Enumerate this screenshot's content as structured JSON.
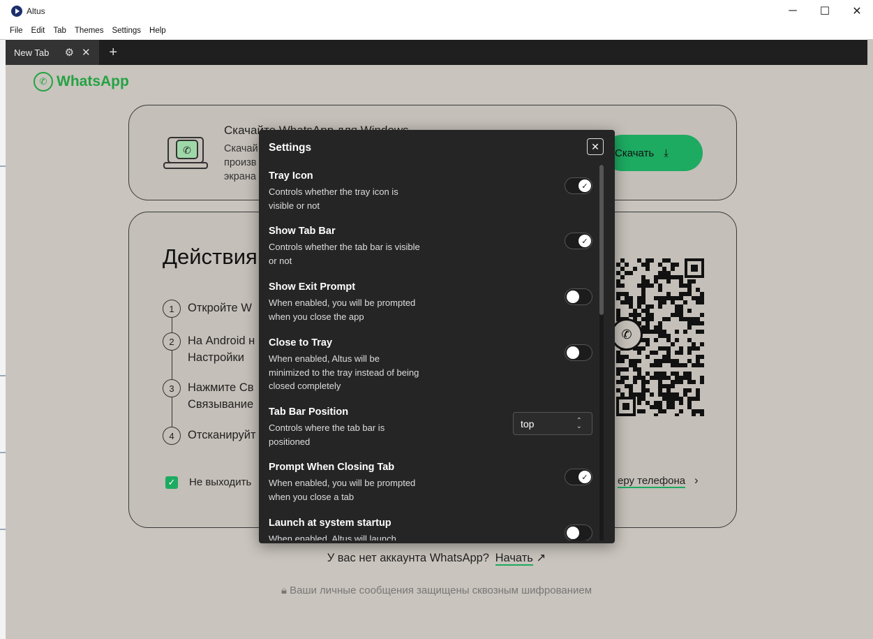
{
  "window": {
    "title": "Altus",
    "minimize": "─",
    "maximize": "☐",
    "close": "✕"
  },
  "menu": [
    "File",
    "Edit",
    "Tab",
    "Themes",
    "Settings",
    "Help"
  ],
  "tab": {
    "label": "New Tab",
    "gear": "⚙",
    "close": "✕",
    "add": "+"
  },
  "whatsapp": {
    "logo_text": "WhatsApp",
    "download": {
      "title": "Скачайте WhatsApp для Windows",
      "desc_lines": [
        "Скачай",
        "произв",
        "экрана"
      ],
      "button": "Скачать"
    },
    "steps": {
      "title": "Действия",
      "items": [
        {
          "num": "1",
          "lines": [
            "Откройте W"
          ]
        },
        {
          "num": "2",
          "lines": [
            "На Android н",
            "Настройки"
          ]
        },
        {
          "num": "3",
          "lines": [
            "Нажмите Св",
            "Связывание"
          ]
        },
        {
          "num": "4",
          "lines": [
            "Отсканируйт"
          ]
        }
      ],
      "keep_signed": "Не выходить",
      "phone_link": "еру телефона"
    },
    "no_account": "У вас нет аккаунта WhatsApp?",
    "start_link": "Начать",
    "e2e": "Ваши личные сообщения защищены сквозным шифрованием"
  },
  "settings": {
    "title": "Settings",
    "close": "✕",
    "items": [
      {
        "name": "Tray Icon",
        "desc": "Controls whether the tray icon is visible or not",
        "on": true
      },
      {
        "name": "Show Tab Bar",
        "desc": "Controls whether the tab bar is visible or not",
        "on": true
      },
      {
        "name": "Show Exit Prompt",
        "desc": "When enabled, you will be prompted when you close the app",
        "on": false
      },
      {
        "name": "Close to Tray",
        "desc": "When enabled, Altus will be minimized to the tray instead of being closed completely",
        "on": false
      },
      {
        "name": "Tab Bar Position",
        "desc": "Controls where the tab bar is positioned",
        "select": "top"
      },
      {
        "name": "Prompt When Closing Tab",
        "desc": "When enabled, you will be prompted when you close a tab",
        "on": true
      },
      {
        "name": "Launch at system startup",
        "desc": "When enabled, Altus will launch",
        "on": false
      }
    ]
  },
  "colors": {
    "accent": "#1daa61",
    "modal_bg": "#252525",
    "page_bg": "#c9c4bd"
  }
}
